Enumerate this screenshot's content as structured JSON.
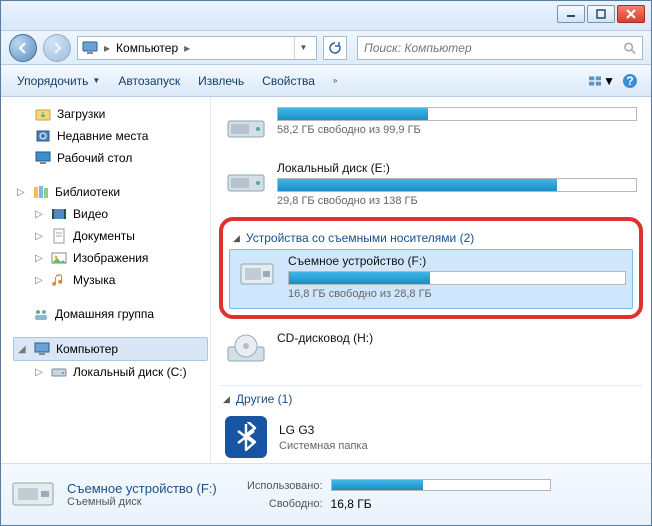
{
  "breadcrumb": {
    "root_label": "Компьютер"
  },
  "search": {
    "placeholder": "Поиск: Компьютер"
  },
  "toolbar": {
    "organize": "Упорядочить",
    "autoplay": "Автозапуск",
    "eject": "Извлечь",
    "properties": "Свойства"
  },
  "sidebar": {
    "downloads": "Загрузки",
    "recent": "Недавние места",
    "desktop": "Рабочий стол",
    "libraries": "Библиотеки",
    "video": "Видео",
    "documents": "Документы",
    "pictures": "Изображения",
    "music": "Музыка",
    "homegroup": "Домашняя группа",
    "computer": "Компьютер",
    "local_c": "Локальный диск (C:)"
  },
  "main": {
    "driveTop": {
      "free_text": "58,2 ГБ свободно из 99,9 ГБ",
      "fill_pct": 42
    },
    "driveE": {
      "name": "Локальный диск (E:)",
      "free_text": "29,8 ГБ свободно из 138 ГБ",
      "fill_pct": 78
    },
    "group_removable": "Устройства со съемными носителями (2)",
    "removableF": {
      "name": "Съемное устройство (F:)",
      "free_text": "16,8 ГБ свободно из 28,8 ГБ",
      "fill_pct": 42
    },
    "cd": {
      "name": "CD-дисковод (H:)"
    },
    "group_other": "Другие (1)",
    "other": {
      "name": "LG G3",
      "subtitle": "Системная папка"
    }
  },
  "details": {
    "title": "Съемное устройство (F:)",
    "subtitle": "Съемный диск",
    "used_label": "Использовано:",
    "free_label": "Свободно:",
    "free_value": "16,8 ГБ",
    "fill_pct": 42
  }
}
